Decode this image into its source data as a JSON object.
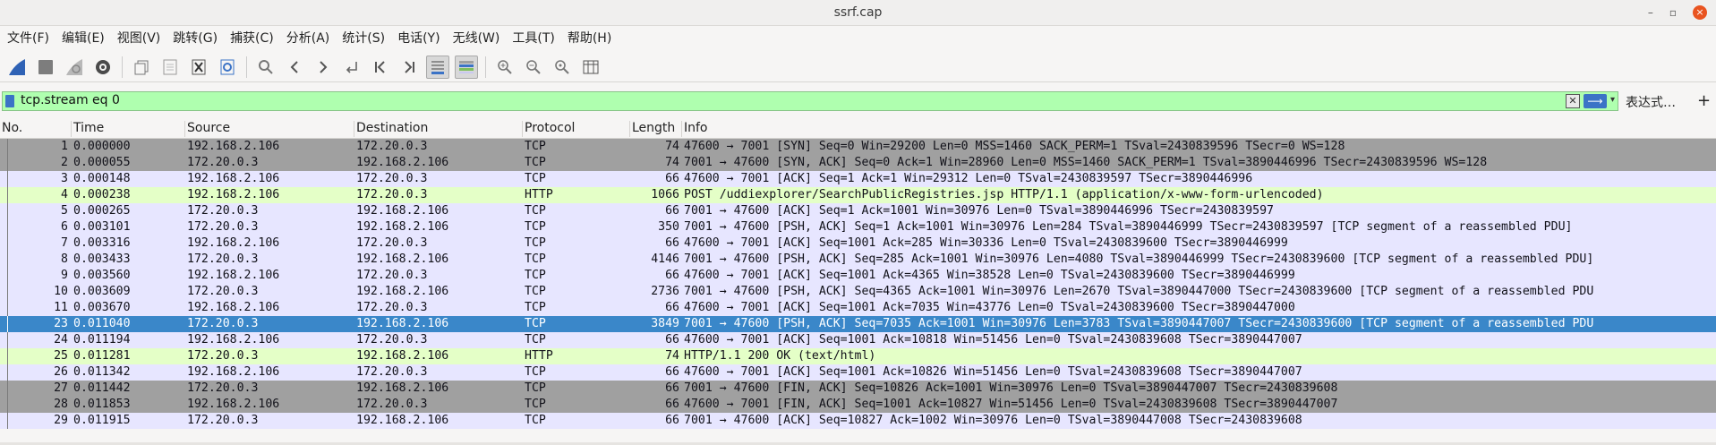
{
  "window": {
    "title": "ssrf.cap",
    "minimize": "–",
    "maximize": "▫",
    "close": "×"
  },
  "menu": [
    "文件(F)",
    "编辑(E)",
    "视图(V)",
    "跳转(G)",
    "捕获(C)",
    "分析(A)",
    "统计(S)",
    "电话(Y)",
    "无线(W)",
    "工具(T)",
    "帮助(H)"
  ],
  "filter": {
    "value": "tcp.stream eq 0",
    "clear": "✕",
    "apply": "⟶",
    "dropdown": "▾",
    "expression": "表达式…",
    "add": "+"
  },
  "columns": {
    "no": "No.",
    "time": "Time",
    "source": "Source",
    "destination": "Destination",
    "protocol": "Protocol",
    "length": "Length",
    "info": "Info"
  },
  "colors": {
    "tcp": "#e7e6ff",
    "http": "#e4ffc7",
    "flagged": "#a0a0a0",
    "selected": "#3a87c9",
    "filter_ok": "#afffaf"
  },
  "packets": [
    {
      "no": "1",
      "time": "0.000000",
      "src": "192.168.2.106",
      "dst": "172.20.0.3",
      "proto": "TCP",
      "len": "74",
      "info": "47600 → 7001 [SYN] Seq=0 Win=29200 Len=0 MSS=1460 SACK_PERM=1 TSval=2430839596 TSecr=0 WS=128",
      "style": "gray"
    },
    {
      "no": "2",
      "time": "0.000055",
      "src": "172.20.0.3",
      "dst": "192.168.2.106",
      "proto": "TCP",
      "len": "74",
      "info": "7001 → 47600 [SYN, ACK] Seq=0 Ack=1 Win=28960 Len=0 MSS=1460 SACK_PERM=1 TSval=3890446996 TSecr=2430839596 WS=128",
      "style": "gray"
    },
    {
      "no": "3",
      "time": "0.000148",
      "src": "192.168.2.106",
      "dst": "172.20.0.3",
      "proto": "TCP",
      "len": "66",
      "info": "47600 → 7001 [ACK] Seq=1 Ack=1 Win=29312 Len=0 TSval=2430839597 TSecr=3890446996",
      "style": "tcp"
    },
    {
      "no": "4",
      "time": "0.000238",
      "src": "192.168.2.106",
      "dst": "172.20.0.3",
      "proto": "HTTP",
      "len": "1066",
      "info": "POST /uddiexplorer/SearchPublicRegistries.jsp HTTP/1.1  (application/x-www-form-urlencoded)",
      "style": "http"
    },
    {
      "no": "5",
      "time": "0.000265",
      "src": "172.20.0.3",
      "dst": "192.168.2.106",
      "proto": "TCP",
      "len": "66",
      "info": "7001 → 47600 [ACK] Seq=1 Ack=1001 Win=30976 Len=0 TSval=3890446996 TSecr=2430839597",
      "style": "tcp"
    },
    {
      "no": "6",
      "time": "0.003101",
      "src": "172.20.0.3",
      "dst": "192.168.2.106",
      "proto": "TCP",
      "len": "350",
      "info": "7001 → 47600 [PSH, ACK] Seq=1 Ack=1001 Win=30976 Len=284 TSval=3890446999 TSecr=2430839597 [TCP segment of a reassembled PDU]",
      "style": "tcp"
    },
    {
      "no": "7",
      "time": "0.003316",
      "src": "192.168.2.106",
      "dst": "172.20.0.3",
      "proto": "TCP",
      "len": "66",
      "info": "47600 → 7001 [ACK] Seq=1001 Ack=285 Win=30336 Len=0 TSval=2430839600 TSecr=3890446999",
      "style": "tcp"
    },
    {
      "no": "8",
      "time": "0.003433",
      "src": "172.20.0.3",
      "dst": "192.168.2.106",
      "proto": "TCP",
      "len": "4146",
      "info": "7001 → 47600 [PSH, ACK] Seq=285 Ack=1001 Win=30976 Len=4080 TSval=3890446999 TSecr=2430839600 [TCP segment of a reassembled PDU]",
      "style": "tcp"
    },
    {
      "no": "9",
      "time": "0.003560",
      "src": "192.168.2.106",
      "dst": "172.20.0.3",
      "proto": "TCP",
      "len": "66",
      "info": "47600 → 7001 [ACK] Seq=1001 Ack=4365 Win=38528 Len=0 TSval=2430839600 TSecr=3890446999",
      "style": "tcp"
    },
    {
      "no": "10",
      "time": "0.003609",
      "src": "172.20.0.3",
      "dst": "192.168.2.106",
      "proto": "TCP",
      "len": "2736",
      "info": "7001 → 47600 [PSH, ACK] Seq=4365 Ack=1001 Win=30976 Len=2670 TSval=3890447000 TSecr=2430839600 [TCP segment of a reassembled PDU",
      "style": "tcp"
    },
    {
      "no": "11",
      "time": "0.003670",
      "src": "192.168.2.106",
      "dst": "172.20.0.3",
      "proto": "TCP",
      "len": "66",
      "info": "47600 → 7001 [ACK] Seq=1001 Ack=7035 Win=43776 Len=0 TSval=2430839600 TSecr=3890447000",
      "style": "tcp"
    },
    {
      "no": "23",
      "time": "0.011040",
      "src": "172.20.0.3",
      "dst": "192.168.2.106",
      "proto": "TCP",
      "len": "3849",
      "info": "7001 → 47600 [PSH, ACK] Seq=7035 Ack=1001 Win=30976 Len=3783 TSval=3890447007 TSecr=2430839600 [TCP segment of a reassembled PDU",
      "style": "sel"
    },
    {
      "no": "24",
      "time": "0.011194",
      "src": "192.168.2.106",
      "dst": "172.20.0.3",
      "proto": "TCP",
      "len": "66",
      "info": "47600 → 7001 [ACK] Seq=1001 Ack=10818 Win=51456 Len=0 TSval=2430839608 TSecr=3890447007",
      "style": "tcp"
    },
    {
      "no": "25",
      "time": "0.011281",
      "src": "172.20.0.3",
      "dst": "192.168.2.106",
      "proto": "HTTP",
      "len": "74",
      "info": "HTTP/1.1 200 OK  (text/html)",
      "style": "http"
    },
    {
      "no": "26",
      "time": "0.011342",
      "src": "192.168.2.106",
      "dst": "172.20.0.3",
      "proto": "TCP",
      "len": "66",
      "info": "47600 → 7001 [ACK] Seq=1001 Ack=10826 Win=51456 Len=0 TSval=2430839608 TSecr=3890447007",
      "style": "tcp"
    },
    {
      "no": "27",
      "time": "0.011442",
      "src": "172.20.0.3",
      "dst": "192.168.2.106",
      "proto": "TCP",
      "len": "66",
      "info": "7001 → 47600 [FIN, ACK] Seq=10826 Ack=1001 Win=30976 Len=0 TSval=3890447007 TSecr=2430839608",
      "style": "gray"
    },
    {
      "no": "28",
      "time": "0.011853",
      "src": "192.168.2.106",
      "dst": "172.20.0.3",
      "proto": "TCP",
      "len": "66",
      "info": "47600 → 7001 [FIN, ACK] Seq=1001 Ack=10827 Win=51456 Len=0 TSval=2430839608 TSecr=3890447007",
      "style": "gray"
    },
    {
      "no": "29",
      "time": "0.011915",
      "src": "172.20.0.3",
      "dst": "192.168.2.106",
      "proto": "TCP",
      "len": "66",
      "info": "7001 → 47600 [ACK] Seq=10827 Ack=1002 Win=30976 Len=0 TSval=3890447008 TSecr=2430839608",
      "style": "tcp"
    }
  ]
}
